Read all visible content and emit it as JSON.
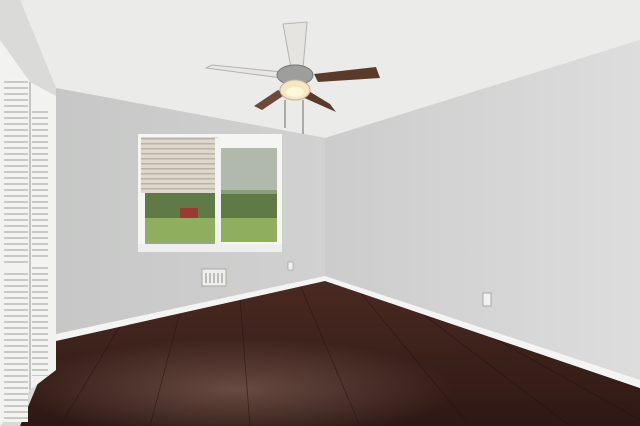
{
  "scene": {
    "type": "empty-bedroom-interior",
    "colors": {
      "ceiling": "#ececea",
      "back_wall": "#cfd0cf",
      "right_wall": "#d8d9d8",
      "left_wall": "#dcdcda",
      "floor": "#3a1f1a",
      "floor_highlight": "#6b4a40",
      "baseboard": "#f4f4f2",
      "fan_blade": "#5a3a2a",
      "fan_blade_light": "#e8e6e2",
      "window_frame": "#f5f5f3",
      "blind": "#d9d4c8",
      "greenery": "#5f7a44",
      "lawn": "#8fae5e",
      "door": "#f2f2f0"
    },
    "objects": [
      "ceiling-fan",
      "ceiling-light",
      "window",
      "window-blind",
      "louvered-closet-door",
      "hardwood-floor",
      "baseboard",
      "air-vent",
      "power-outlet"
    ]
  }
}
